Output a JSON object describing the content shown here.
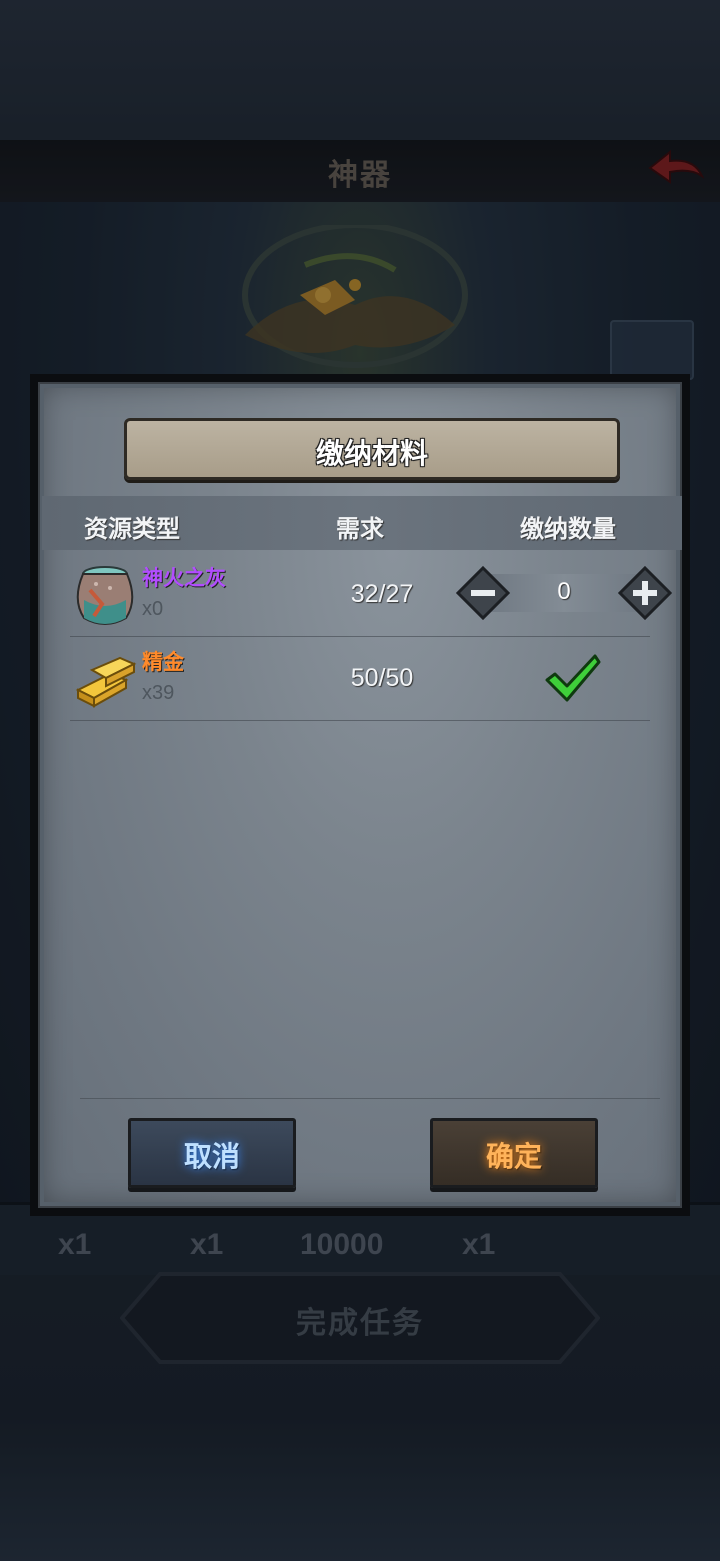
{
  "background": {
    "title": "神器",
    "rewards": [
      "x1",
      "x1",
      "10000",
      "x1"
    ],
    "complete_button": "完成任务"
  },
  "dialog": {
    "title": "缴纳材料",
    "columns": {
      "resource": "资源类型",
      "requirement": "需求",
      "amount": "缴纳数量"
    },
    "rows": [
      {
        "name": "神火之灰",
        "name_color": "#b24dff",
        "count": "x0",
        "requirement": "32/27",
        "amount": "0",
        "icon": "ash-urn-icon"
      },
      {
        "name": "精金",
        "name_color": "#ff8a2a",
        "count": "x39",
        "requirement": "50/50",
        "status": "complete",
        "icon": "gold-bars-icon"
      }
    ],
    "cancel_label": "取消",
    "confirm_label": "确定"
  }
}
